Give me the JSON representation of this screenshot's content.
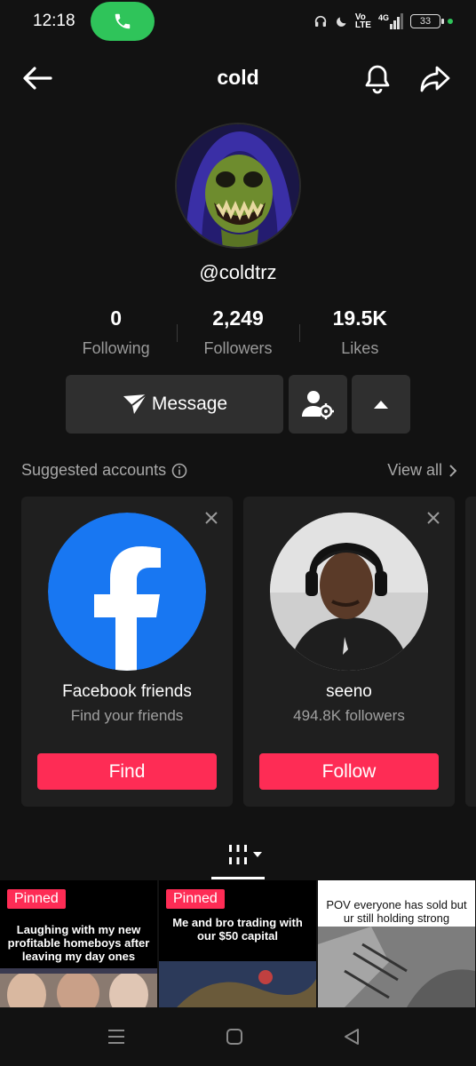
{
  "status": {
    "time": "12:18",
    "network_top": "Vo",
    "network_bottom": "LTE",
    "signal_label": "4G",
    "battery": "33"
  },
  "header": {
    "title": "cold"
  },
  "profile": {
    "username": "@coldtrz",
    "stats": [
      {
        "value": "0",
        "label": "Following"
      },
      {
        "value": "2,249",
        "label": "Followers"
      },
      {
        "value": "19.5K",
        "label": "Likes"
      }
    ],
    "message_label": "Message"
  },
  "suggested": {
    "title": "Suggested accounts",
    "view_all": "View all",
    "cards": [
      {
        "name": "Facebook friends",
        "subtitle": "Find your friends",
        "button": "Find"
      },
      {
        "name": "seeno",
        "subtitle": "494.8K followers",
        "button": "Follow"
      }
    ]
  },
  "videos": [
    {
      "badge": "Pinned",
      "caption": "Laughing with my new profitable homeboys after leaving my day ones"
    },
    {
      "badge": "Pinned",
      "caption": "Me and bro trading with our $50 capital"
    },
    {
      "badge": "",
      "caption": "POV everyone has sold but ur still holding strong"
    }
  ],
  "colors": {
    "accent": "#fe2c55",
    "background": "#121212",
    "call_green": "#2fc45a",
    "facebook_blue": "#1877f2"
  },
  "icons": [
    "back-arrow-icon",
    "bell-icon",
    "share-icon",
    "send-icon",
    "person-settings-icon",
    "caret-up-icon",
    "info-icon",
    "chevron-right-icon",
    "close-icon",
    "grid-icon"
  ]
}
